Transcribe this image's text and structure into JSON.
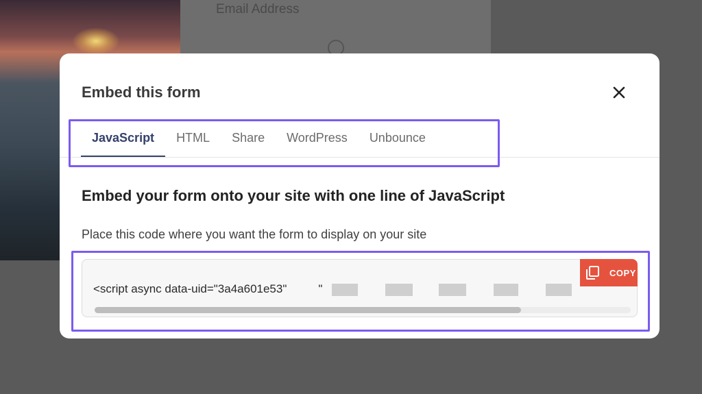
{
  "background": {
    "email_label": "Email Address"
  },
  "modal": {
    "title": "Embed this form",
    "tabs": [
      {
        "label": "JavaScript",
        "active": true
      },
      {
        "label": "HTML",
        "active": false
      },
      {
        "label": "Share",
        "active": false
      },
      {
        "label": "WordPress",
        "active": false
      },
      {
        "label": "Unbounce",
        "active": false
      }
    ],
    "heading": "Embed your form onto your site with one line of JavaScript",
    "subtext": "Place this code where you want the form to display on your site",
    "code": {
      "visible_text": "<script async data-uid=\"3a4a601e53\"",
      "continuation_fragment": "\"",
      "copy_label": "COPY",
      "scroll_position": 0.0
    }
  },
  "colors": {
    "accent_tab": "#34416b",
    "copy_button": "#e5533f",
    "highlight_outline": "#7b5bf0"
  },
  "icons": {
    "close": "close-icon",
    "copy": "copy-icon"
  }
}
